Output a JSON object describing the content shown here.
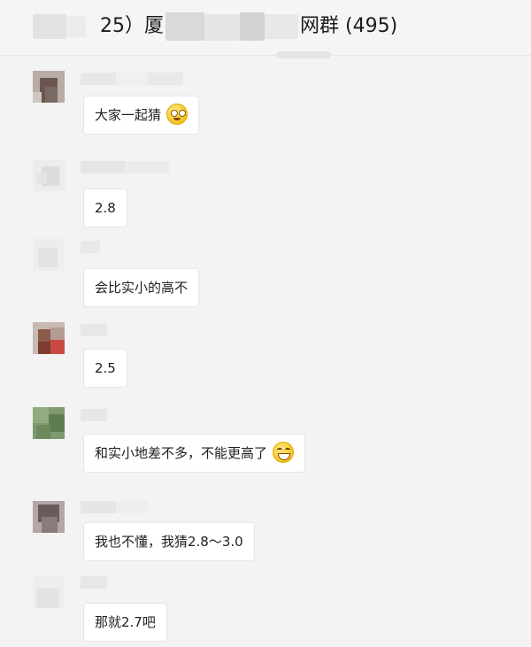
{
  "header": {
    "title_fragment_1": "25）厦",
    "title_fragment_2": "网群 (495)"
  },
  "messages": [
    {
      "text": "大家一起猜",
      "emoji": "flushed-face-icon"
    },
    {
      "text": "2.8"
    },
    {
      "text": "会比实小的高不"
    },
    {
      "text": "2.5"
    },
    {
      "text": "和实小地差不多，不能更高了",
      "emoji": "grinning-face-icon"
    },
    {
      "text": "我也不懂，我猜2.8～3.0"
    },
    {
      "text": "那就2.7吧"
    }
  ]
}
